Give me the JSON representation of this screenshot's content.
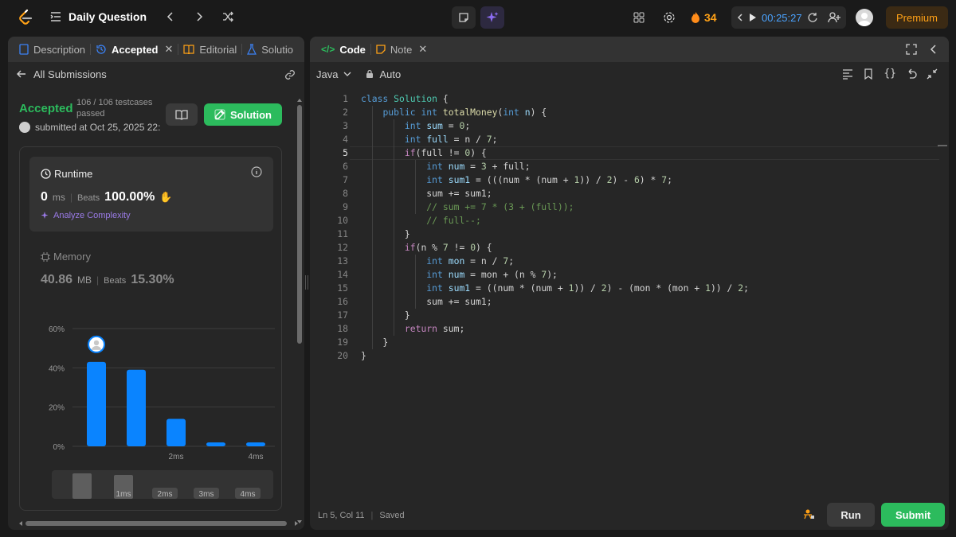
{
  "topbar": {
    "title": "Daily Question",
    "streak": "34",
    "timer": "00:25:27",
    "premium": "Premium"
  },
  "left": {
    "tabs": [
      {
        "label": "Description"
      },
      {
        "label": "Accepted"
      },
      {
        "label": "Editorial"
      },
      {
        "label": "Solutio"
      }
    ],
    "back": "All Submissions",
    "status": "Accepted",
    "testcases": "106 / 106 testcases passed",
    "submitted": "submitted at Oct 25, 2025 22:",
    "solution_btn": "Solution",
    "runtime": {
      "title": "Runtime",
      "value": "0",
      "unit": "ms",
      "beats_label": "Beats",
      "beats": "100.00%",
      "analyze": "Analyze Complexity"
    },
    "memory": {
      "title": "Memory",
      "value": "40.86",
      "unit": "MB",
      "beats_label": "Beats",
      "beats": "15.30%"
    }
  },
  "chart_data": {
    "type": "bar",
    "yticks": [
      "60%",
      "40%",
      "20%",
      "0%"
    ],
    "ylim": [
      0,
      60
    ],
    "values": [
      43,
      39,
      14,
      2,
      2
    ],
    "xticks": [
      "",
      "",
      "2ms",
      "",
      "4ms"
    ],
    "mini_labels": [
      "",
      "1ms",
      "2ms",
      "3ms",
      "4ms"
    ],
    "bar_color": "#0a84ff"
  },
  "editor": {
    "tabs": [
      {
        "label": "Code"
      },
      {
        "label": "Note"
      }
    ],
    "language": "Java",
    "mode": "Auto",
    "status_pos": "Ln 5, Col 11",
    "status_saved": "Saved",
    "run": "Run",
    "submit": "Submit"
  }
}
